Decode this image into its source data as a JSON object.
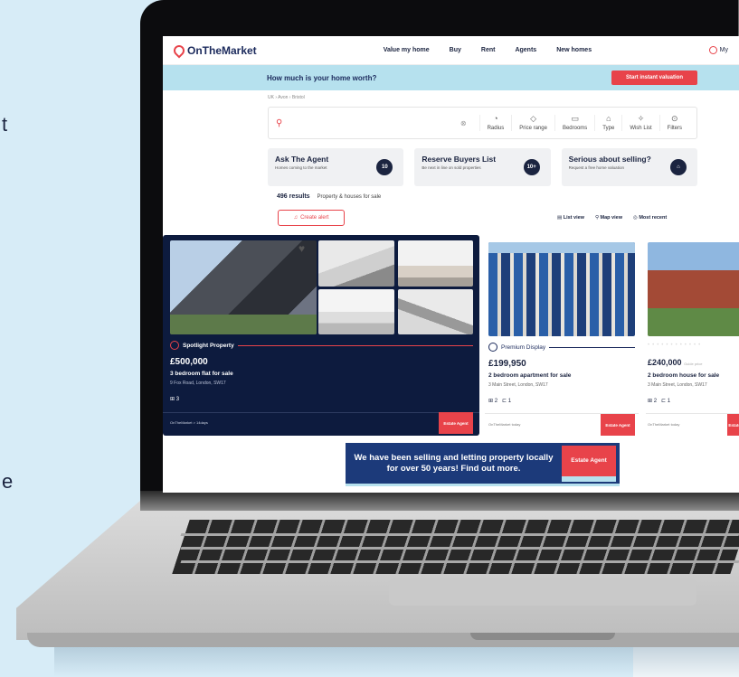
{
  "background_fragments": [
    "t",
    "e"
  ],
  "site": {
    "logo": "OnTheMarket",
    "nav": [
      "Value my home",
      "Buy",
      "Rent",
      "Agents",
      "New homes"
    ],
    "account": "My"
  },
  "valuation": {
    "question": "How much is your home worth?",
    "button": "Start instant valuation"
  },
  "breadcrumb": "UK › Avon › Bristol",
  "search": {
    "filters": [
      {
        "icon": "radius-icon",
        "label": "Radius"
      },
      {
        "icon": "price-tag-icon",
        "label": "Price range"
      },
      {
        "icon": "bed-icon",
        "label": "Bedrooms"
      },
      {
        "icon": "home-icon",
        "label": "Type"
      },
      {
        "icon": "wishlist-icon",
        "label": "Wish List"
      },
      {
        "icon": "filters-icon",
        "label": "Filters"
      }
    ]
  },
  "promos": [
    {
      "title": "Ask The Agent",
      "subtitle": "Homes coming to the market",
      "badge": "10"
    },
    {
      "title": "Reserve Buyers List",
      "subtitle": "Be next in line on sold properties",
      "badge": "10+"
    },
    {
      "title": "Serious about selling?",
      "subtitle": "Request a free home valuation",
      "badge": "⌂"
    }
  ],
  "results": {
    "count": "496 results",
    "label": "Property & houses for sale",
    "create_alert": "Create alert",
    "views": [
      "List view",
      "Map view",
      "Most recent"
    ]
  },
  "listings": {
    "spotlight": {
      "label": "Spotlight Property",
      "price": "£500,000",
      "title": "3 bedroom flat for sale",
      "address": "9 Fox Road, London, SW17",
      "beds": "3",
      "meta": "OnTheMarket > 14days",
      "agent": "Estate Agent"
    },
    "premium": {
      "label": "Premium Display",
      "price": "£199,950",
      "title": "2 bedroom apartment for sale",
      "address": "3 Main Street, London, SW17",
      "beds": "2",
      "baths": "1",
      "meta": "OnTheMarket today",
      "agent": "Estate Agent"
    },
    "third": {
      "price": "£240,000",
      "guide": "Guide price",
      "title": "2 bedroom house for sale",
      "address": "3 Main Street, London, SW17",
      "beds": "2",
      "baths": "1",
      "meta": "OnTheMarket today",
      "agent": "Estate Agent"
    }
  },
  "banner": {
    "text": "We have been selling and letting property locally for over 50 years! Find out more.",
    "agent": "Estate Agent"
  },
  "colors": {
    "accent": "#e8434a",
    "navy": "#0d1b3e",
    "light_blue": "#b6e1ee",
    "banner_blue": "#1c3a7a"
  }
}
